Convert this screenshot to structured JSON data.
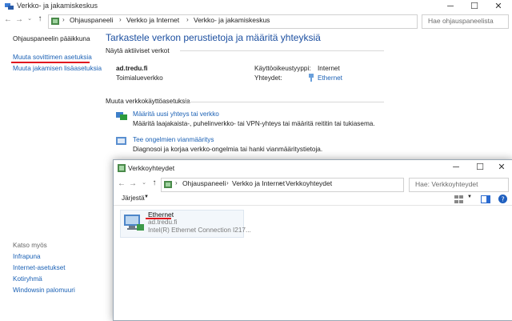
{
  "parent_window": {
    "title": "Verkko- ja jakamiskeskus",
    "controls": {
      "minimize": "─",
      "maximize": "☐",
      "close": "✕"
    },
    "address": {
      "crumbs": [
        "Ohjauspaneeli",
        "Verkko ja Internet",
        "Verkko- ja jakamiskeskus"
      ],
      "separator": "›",
      "search_placeholder": "Hae ohjauspaneelista"
    },
    "sidebar": {
      "home": "Ohjauspaneelin pääikkuna",
      "links": [
        "Muuta sovittimen asetuksia",
        "Muuta jakamisen lisäasetuksia"
      ],
      "see_also_title": "Katso myös",
      "see_also": [
        "Infrapuna",
        "Internet-asetukset",
        "Kotiryhmä",
        "Windowsin palomuuri"
      ]
    },
    "main": {
      "heading": "Tarkastele verkon perustietoja ja määritä yhteyksiä",
      "active_networks_title": "Näytä aktiiviset verkot",
      "network_name": "ad.tredu.fi",
      "network_type": "Toimialueverkko",
      "access_type_label": "Käyttöoikeustyyppi:",
      "access_type_value": "Internet",
      "connections_label": "Yhteydet:",
      "connections_value": "Ethernet",
      "change_settings_title": "Muuta verkkokäyttöasetuksia",
      "tasks": [
        {
          "link": "Määritä uusi yhteys tai verkko",
          "desc": "Määritä laajakaista-, puhelinverkko- tai VPN-yhteys tai määritä reititin tai tukiasema."
        },
        {
          "link": "Tee ongelmien vianmääritys",
          "desc": "Diagnosoi ja korjaa verkko-ongelmia tai hanki vianmääritystietoja."
        }
      ]
    }
  },
  "child_window": {
    "title": "Verkkoyhteydet",
    "controls": {
      "minimize": "─",
      "maximize": "☐",
      "close": "✕"
    },
    "address": {
      "crumbs": [
        "Ohjauspaneeli",
        "Verkko ja Internet",
        "Verkkoyhteydet"
      ],
      "separator": "›",
      "search_placeholder": "Hae: Verkkoyhteydet"
    },
    "organize_label": "Järjestä",
    "adapter": {
      "name": "Ethernet",
      "network": "ad.tredu.fi",
      "device": "Intel(R) Ethernet Connection I217..."
    }
  },
  "colors": {
    "link": "#1b61b5",
    "heading": "#1c4fa0",
    "underline": "#e0141e"
  }
}
